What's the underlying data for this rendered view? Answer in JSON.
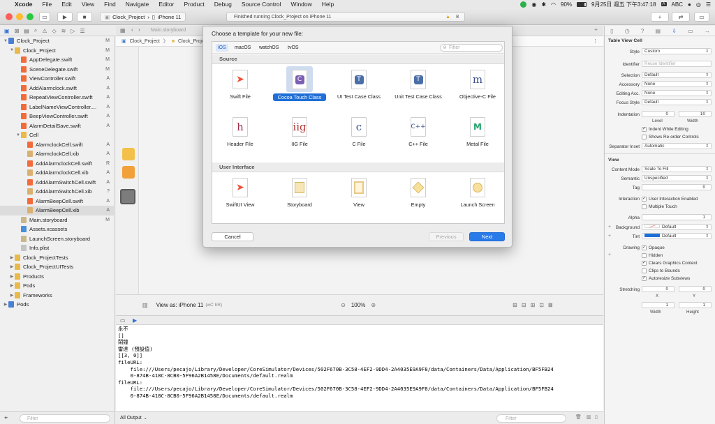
{
  "menubar": {
    "apple": "",
    "items": [
      "Xcode",
      "File",
      "Edit",
      "View",
      "Find",
      "Navigate",
      "Editor",
      "Product",
      "Debug",
      "Source Control",
      "Window",
      "Help"
    ],
    "battery": "90%",
    "datetime": "9月25日 週五 下午3:47:18",
    "input_method": "ABC"
  },
  "toolbar": {
    "scheme": "Clock_Project",
    "device": "iPhone 11",
    "status": "Finished running Clock_Project on iPhone 11",
    "warning_count": "8"
  },
  "navigator": {
    "filter_placeholder": "Filter",
    "items": [
      {
        "label": "Clock_Project",
        "level": 0,
        "icon": "project-icon",
        "status": "M",
        "open": true
      },
      {
        "label": "Clock_Project",
        "level": 1,
        "icon": "folder-icon",
        "status": "M",
        "open": true
      },
      {
        "label": "AppDelegate.swift",
        "level": 2,
        "icon": "swift-icon",
        "status": "M"
      },
      {
        "label": "SceneDelegate.swift",
        "level": 2,
        "icon": "swift-icon",
        "status": "M"
      },
      {
        "label": "ViewController.swift",
        "level": 2,
        "icon": "swift-icon",
        "status": "A"
      },
      {
        "label": "AddAlarmclock.swift",
        "level": 2,
        "icon": "swift-icon",
        "status": "A"
      },
      {
        "label": "RepeatViewController.swift",
        "level": 2,
        "icon": "swift-icon",
        "status": "A"
      },
      {
        "label": "LabelNameViewController....",
        "level": 2,
        "icon": "swift-icon",
        "status": "A"
      },
      {
        "label": "BeepViewController.swift",
        "level": 2,
        "icon": "swift-icon",
        "status": "A"
      },
      {
        "label": "AlarmDetailSave.swift",
        "level": 2,
        "icon": "swift-icon",
        "status": "A"
      },
      {
        "label": "Cell",
        "level": 2,
        "icon": "folder-icon",
        "status": "",
        "open": true
      },
      {
        "label": "AlarmclockCell.swift",
        "level": 3,
        "icon": "swift-icon",
        "status": "A"
      },
      {
        "label": "AlarmclockCell.xib",
        "level": 3,
        "icon": "xib-icon",
        "status": "A"
      },
      {
        "label": "AddAlarmclockCell.swift",
        "level": 3,
        "icon": "swift-icon",
        "status": "R"
      },
      {
        "label": "AddAlarmclockCell.xib",
        "level": 3,
        "icon": "xib-icon",
        "status": "A"
      },
      {
        "label": "AddAlarmSwitchCell.swift",
        "level": 3,
        "icon": "swift-icon",
        "status": "A"
      },
      {
        "label": "AddAlarmSwitchCell.xib",
        "level": 3,
        "icon": "xib-icon",
        "status": "?"
      },
      {
        "label": "AlarmBeepCell.swift",
        "level": 3,
        "icon": "swift-icon",
        "status": "A"
      },
      {
        "label": "AlarmBeepCell.xib",
        "level": 3,
        "icon": "xib-icon",
        "status": "A",
        "selected": true
      },
      {
        "label": "Main.storyboard",
        "level": 2,
        "icon": "storyboard-icon",
        "status": "M"
      },
      {
        "label": "Assets.xcassets",
        "level": 2,
        "icon": "assets-icon",
        "status": ""
      },
      {
        "label": "LaunchScreen.storyboard",
        "level": 2,
        "icon": "storyboard-icon",
        "status": ""
      },
      {
        "label": "Info.plist",
        "level": 2,
        "icon": "plist-icon",
        "status": ""
      },
      {
        "label": "Clock_ProjectTests",
        "level": 1,
        "icon": "folder-icon",
        "status": "",
        "open": false
      },
      {
        "label": "Clock_ProjectUITests",
        "level": 1,
        "icon": "folder-icon",
        "status": "",
        "open": false
      },
      {
        "label": "Products",
        "level": 1,
        "icon": "folder-icon",
        "status": "",
        "open": false
      },
      {
        "label": "Pods",
        "level": 1,
        "icon": "folder-icon",
        "status": "",
        "open": false
      },
      {
        "label": "Frameworks",
        "level": 1,
        "icon": "folder-icon",
        "status": "",
        "open": false
      },
      {
        "label": "Pods",
        "level": 0,
        "icon": "project-icon",
        "status": "",
        "open": false
      }
    ]
  },
  "editor": {
    "tab": "Main.storyboard",
    "jump_bar": [
      "Clock_Project",
      "Clock_Project"
    ],
    "view_as": "View as: iPhone 11",
    "view_as_suffix": "(wC hR)",
    "zoom": "100%"
  },
  "console": {
    "lines": [
      "永不",
      "[]",
      "鬧鐘",
      "雷達 (預設值)",
      "[[3, 0]]",
      "fileURL:",
      "    file:///Users/pecajo/Library/Developer/CoreSimulator/Devices/502F670B-3C58-4EF2-9DD4-2A4035E9A9F8/data/Containers/Data/Application/BF5FB24",
      "    0-874B-418C-8CB0-5F96A2B1458E/Documents/default.realm",
      "fileURL:",
      "    file:///Users/pecajo/Library/Developer/CoreSimulator/Devices/502F670B-3C58-4EF2-9DD4-2A4035E9A9F8/data/Containers/Data/Application/BF5FB24",
      "    0-874B-418C-8CB0-5F96A2B1458E/Documents/default.realm"
    ],
    "output_selector": "All Output",
    "filter_placeholder": "Filter"
  },
  "dialog": {
    "title": "Choose a template for your new file:",
    "platforms": [
      "iOS",
      "macOS",
      "watchOS",
      "tvOS"
    ],
    "filter_placeholder": "Filter",
    "source_header": "Source",
    "ui_header": "User Interface",
    "source_templates": [
      {
        "label": "Swift File",
        "glyph": "",
        "icon": "swift-file-icon"
      },
      {
        "label": "Cocoa Touch Class",
        "glyph": "C",
        "icon": "cocoa-touch-class-icon",
        "selected": true
      },
      {
        "label": "UI Test Case Class",
        "glyph": "T",
        "icon": "ui-test-case-icon"
      },
      {
        "label": "Unit Test Case Class",
        "glyph": "T",
        "icon": "unit-test-case-icon"
      },
      {
        "label": "Objective-C File",
        "glyph": "m",
        "icon": "objective-c-file-icon"
      },
      {
        "label": "Header File",
        "glyph": "h",
        "icon": "header-file-icon"
      },
      {
        "label": "IIG File",
        "glyph": "iig",
        "icon": "iig-file-icon"
      },
      {
        "label": "C File",
        "glyph": "c",
        "icon": "c-file-icon"
      },
      {
        "label": "C++ File",
        "glyph": "C++",
        "icon": "cpp-file-icon"
      },
      {
        "label": "Metal File",
        "glyph": "M",
        "icon": "metal-file-icon"
      }
    ],
    "ui_templates": [
      {
        "label": "SwiftUI View",
        "icon": "swiftui-view-icon"
      },
      {
        "label": "Storyboard",
        "icon": "storyboard-template-icon"
      },
      {
        "label": "View",
        "icon": "view-template-icon"
      },
      {
        "label": "Empty",
        "icon": "empty-template-icon"
      },
      {
        "label": "Launch Screen",
        "icon": "launch-screen-icon"
      }
    ],
    "cancel": "Cancel",
    "previous": "Previous",
    "next": "Next"
  },
  "inspector": {
    "header": "Table View Cell",
    "style": "Custom",
    "identifier_placeholder": "Reuse Identifier",
    "selection": "Default",
    "accessory": "None",
    "editing_acc": "None",
    "focus_style": "Default",
    "indentation": "0",
    "indentation_width": "10",
    "level_label": "Level",
    "width_label": "Width",
    "indent_while_editing": "Indent While Editing",
    "shows_reorder": "Shows Re-order Controls",
    "separator_inset": "Automatic",
    "view_header": "View",
    "content_mode": "Scale To Fill",
    "semantic": "Unspecified",
    "tag": "0",
    "user_interaction": "User Interaction Enabled",
    "multiple_touch": "Multiple Touch",
    "alpha": "1",
    "background": "Default",
    "tint": "Default",
    "opaque": "Opaque",
    "hidden": "Hidden",
    "clears_graphics": "Clears Graphics Context",
    "clips_to_bounds": "Clips to Bounds",
    "autoresize": "Autoresize Subviews",
    "stretch_x": "0",
    "stretch_y": "0",
    "stretch_w": "1",
    "stretch_h": "1",
    "labels": {
      "style": "Style",
      "identifier": "Identifier",
      "selection": "Selection",
      "accessory": "Accessory",
      "editing": "Editing Acc.",
      "focus": "Focus Style",
      "indentation": "Indentation",
      "separator": "Separator Inset",
      "content_mode": "Content Mode",
      "semantic": "Semantic",
      "tag": "Tag",
      "interaction": "Interaction",
      "alpha": "Alpha",
      "background": "Background",
      "tint": "Tint",
      "drawing": "Drawing",
      "stretching": "Stretching",
      "x": "X",
      "y": "Y",
      "width": "Width",
      "height": "Height"
    }
  }
}
